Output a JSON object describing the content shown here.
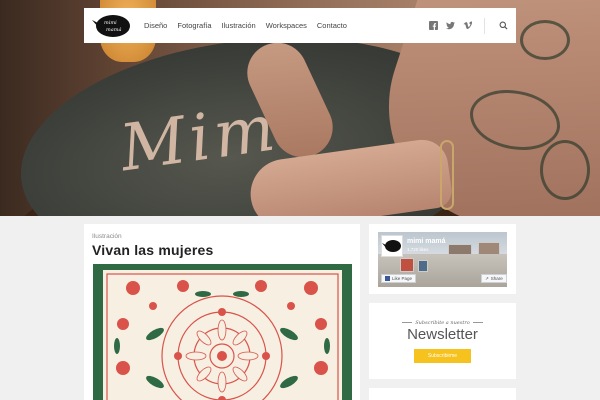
{
  "nav": {
    "logo_alt": "mimi mamá",
    "items": [
      "Diseño",
      "Fotografía",
      "Ilustración",
      "Workspaces",
      "Contacto"
    ],
    "social_icons": [
      "facebook-icon",
      "twitter-icon",
      "vimeo-icon"
    ],
    "search_icon": "search-icon"
  },
  "hero": {
    "chalk_text": "Mimí"
  },
  "post": {
    "category": "Ilustración",
    "title": "Vivan las mujeres"
  },
  "facebook_widget": {
    "page_name": "mimi mamá",
    "likes": "1,720 likes",
    "like_button": "Like Page",
    "share_button": "Share",
    "accent": "#3b5998"
  },
  "newsletter": {
    "pre_title": "Subscribite a nuestro",
    "title": "Newsletter",
    "button": "Subscribirme",
    "accent": "#f6c21d"
  },
  "colors": {
    "background": "#f0f0f0",
    "art_green": "#2f6a44",
    "art_red": "#d9534a"
  }
}
